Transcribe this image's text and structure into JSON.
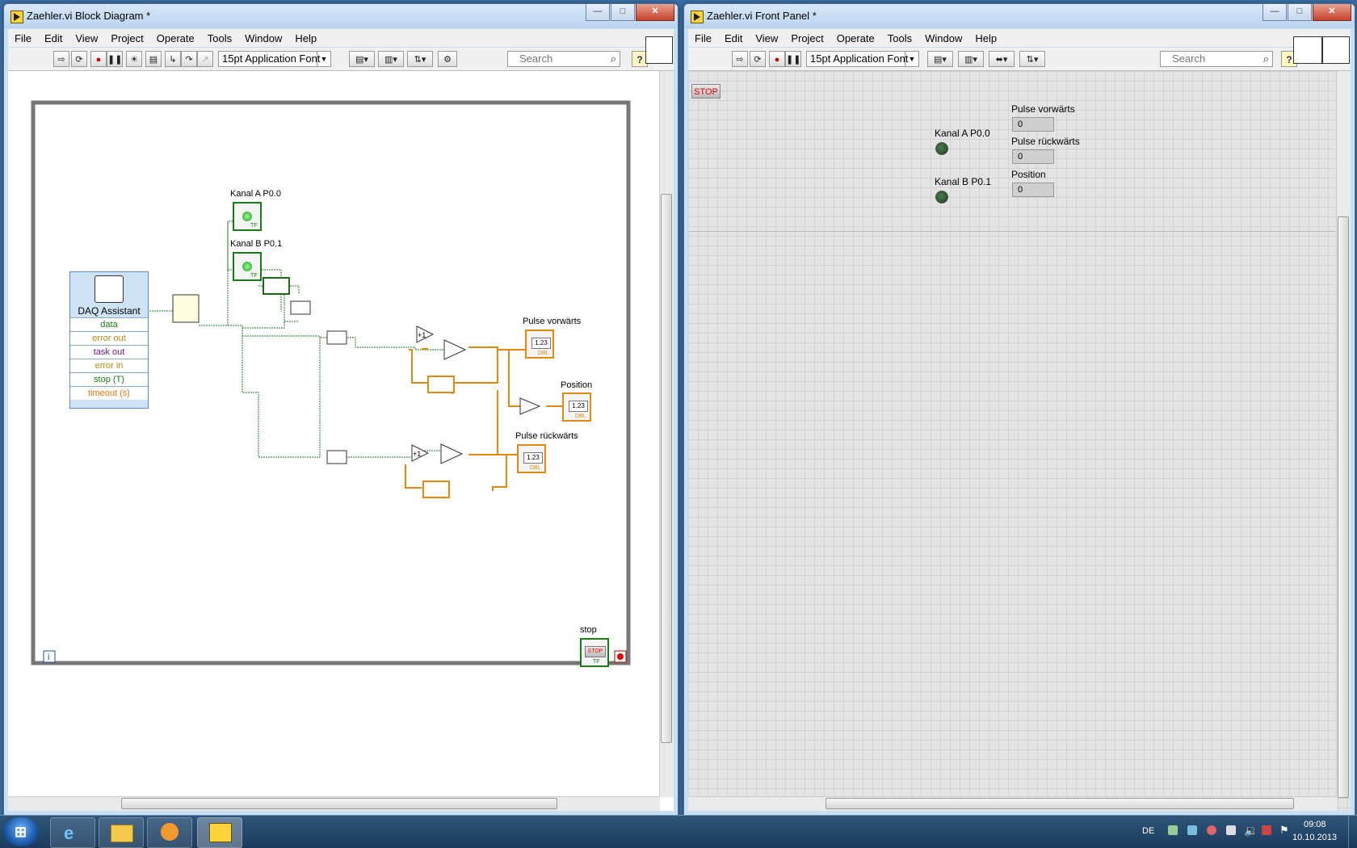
{
  "left_window": {
    "title": "Zaehler.vi Block Diagram *",
    "menu": [
      "File",
      "Edit",
      "View",
      "Project",
      "Operate",
      "Tools",
      "Window",
      "Help"
    ],
    "font_select": "15pt Application Font",
    "search_placeholder": "Search",
    "diagram": {
      "daq_title": "DAQ Assistant",
      "daq_terminals": [
        {
          "label": "data",
          "color": "#1a7a1a"
        },
        {
          "label": "error out",
          "color": "#b5891a"
        },
        {
          "label": "task out",
          "color": "#6a1a8a"
        },
        {
          "label": "error in",
          "color": "#b5891a"
        },
        {
          "label": "stop (T)",
          "color": "#1a7a1a"
        },
        {
          "label": "timeout (s)",
          "color": "#e07a10"
        }
      ],
      "labels": {
        "kanal_a": "Kanal A P0.0",
        "kanal_b": "Kanal B P0.1",
        "pulse_vorwaerts": "Pulse vorwärts",
        "pulse_rueckwaerts": "Pulse rückwärts",
        "position": "Position",
        "stop": "stop",
        "num_ind": "1.23",
        "stop_btn": "STOP",
        "tf": "TF",
        "dbl": "DBL",
        "inc": "+1",
        "loop_iter": "i"
      }
    }
  },
  "right_window": {
    "title": "Zaehler.vi Front Panel *",
    "menu": [
      "File",
      "Edit",
      "View",
      "Project",
      "Operate",
      "Tools",
      "Window",
      "Help"
    ],
    "font_select": "15pt Application Font",
    "search_placeholder": "Search",
    "panel": {
      "stop_label": "STOP",
      "kanal_a": "Kanal A P0.0",
      "kanal_b": "Kanal B P0.1",
      "pulse_vorwaerts_label": "Pulse vorwärts",
      "pulse_vorwaerts_value": "0",
      "pulse_rueckwaerts_label": "Pulse rückwärts",
      "pulse_rueckwaerts_value": "0",
      "position_label": "Position",
      "position_value": "0"
    }
  },
  "taskbar": {
    "language": "DE",
    "time": "09:08",
    "date": "10.10.2013"
  }
}
